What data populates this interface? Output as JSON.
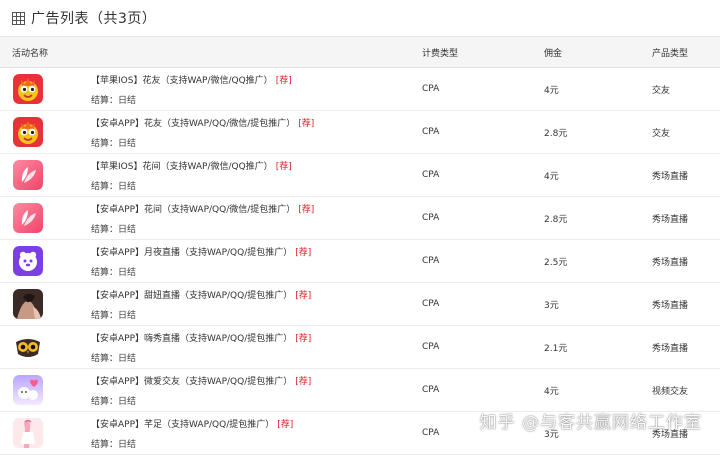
{
  "page": {
    "title": "广告列表（共3页）",
    "icon": "table-grid-icon"
  },
  "columns": {
    "name": "活动名称",
    "fee_type": "计费类型",
    "commission": "佣金",
    "category": "产品类型"
  },
  "rows": [
    {
      "title": "【苹果IOS】花友（支持WAP/微信/QQ推广）",
      "tag": "[荐]",
      "settle_label": "结算：",
      "settle_value": "日结",
      "fee_type": "CPA",
      "commission": "4元",
      "category": "交友",
      "icon": "huayou-app-icon"
    },
    {
      "title": "【安卓APP】花友（支持WAP/QQ/微信/提包推广）",
      "tag": "[荐]",
      "settle_label": "结算：",
      "settle_value": "日结",
      "fee_type": "CPA",
      "commission": "2.8元",
      "category": "交友",
      "icon": "huayou-app-icon"
    },
    {
      "title": "【苹果IOS】花间（支持WAP/微信/QQ推广）",
      "tag": "[荐]",
      "settle_label": "结算：",
      "settle_value": "日结",
      "fee_type": "CPA",
      "commission": "4元",
      "category": "秀场直播",
      "icon": "huajian-app-icon"
    },
    {
      "title": "【安卓APP】花间（支持WAP/QQ/微信/提包推广）",
      "tag": "[荐]",
      "settle_label": "结算：",
      "settle_value": "日结",
      "fee_type": "CPA",
      "commission": "2.8元",
      "category": "秀场直播",
      "icon": "huajian-app-icon"
    },
    {
      "title": "【安卓APP】月夜直播（支持WAP/QQ/提包推广）",
      "tag": "[荐]",
      "settle_label": "结算：",
      "settle_value": "日结",
      "fee_type": "CPA",
      "commission": "2.5元",
      "category": "秀场直播",
      "icon": "yueye-app-icon"
    },
    {
      "title": "【安卓APP】甜妞直播（支持WAP/QQ/提包推广）",
      "tag": "[荐]",
      "settle_label": "结算：",
      "settle_value": "日结",
      "fee_type": "CPA",
      "commission": "3元",
      "category": "秀场直播",
      "icon": "tianniu-app-icon"
    },
    {
      "title": "【安卓APP】嗨秀直播（支持WAP/QQ/提包推广）",
      "tag": "[荐]",
      "settle_label": "结算：",
      "settle_value": "日结",
      "fee_type": "CPA",
      "commission": "2.1元",
      "category": "秀场直播",
      "icon": "owl-app-icon"
    },
    {
      "title": "【安卓APP】微爱交友（支持WAP/QQ/提包推广）",
      "tag": "[荐]",
      "settle_label": "结算：",
      "settle_value": "日结",
      "fee_type": "CPA",
      "commission": "4元",
      "category": "视频交友",
      "icon": "weiai-app-icon"
    },
    {
      "title": "【安卓APP】芊足（支持WAP/QQ/提包推广）",
      "tag": "[荐]",
      "settle_label": "结算：",
      "settle_value": "日结",
      "fee_type": "CPA",
      "commission": "3元",
      "category": "秀场直播",
      "icon": "qianzu-app-icon"
    }
  ],
  "watermark": "知乎 @与客共赢网络工作室",
  "colors": {
    "header_bg": "#f5f5f5",
    "recommend_red": "#d9262c",
    "border": "#ececec"
  }
}
